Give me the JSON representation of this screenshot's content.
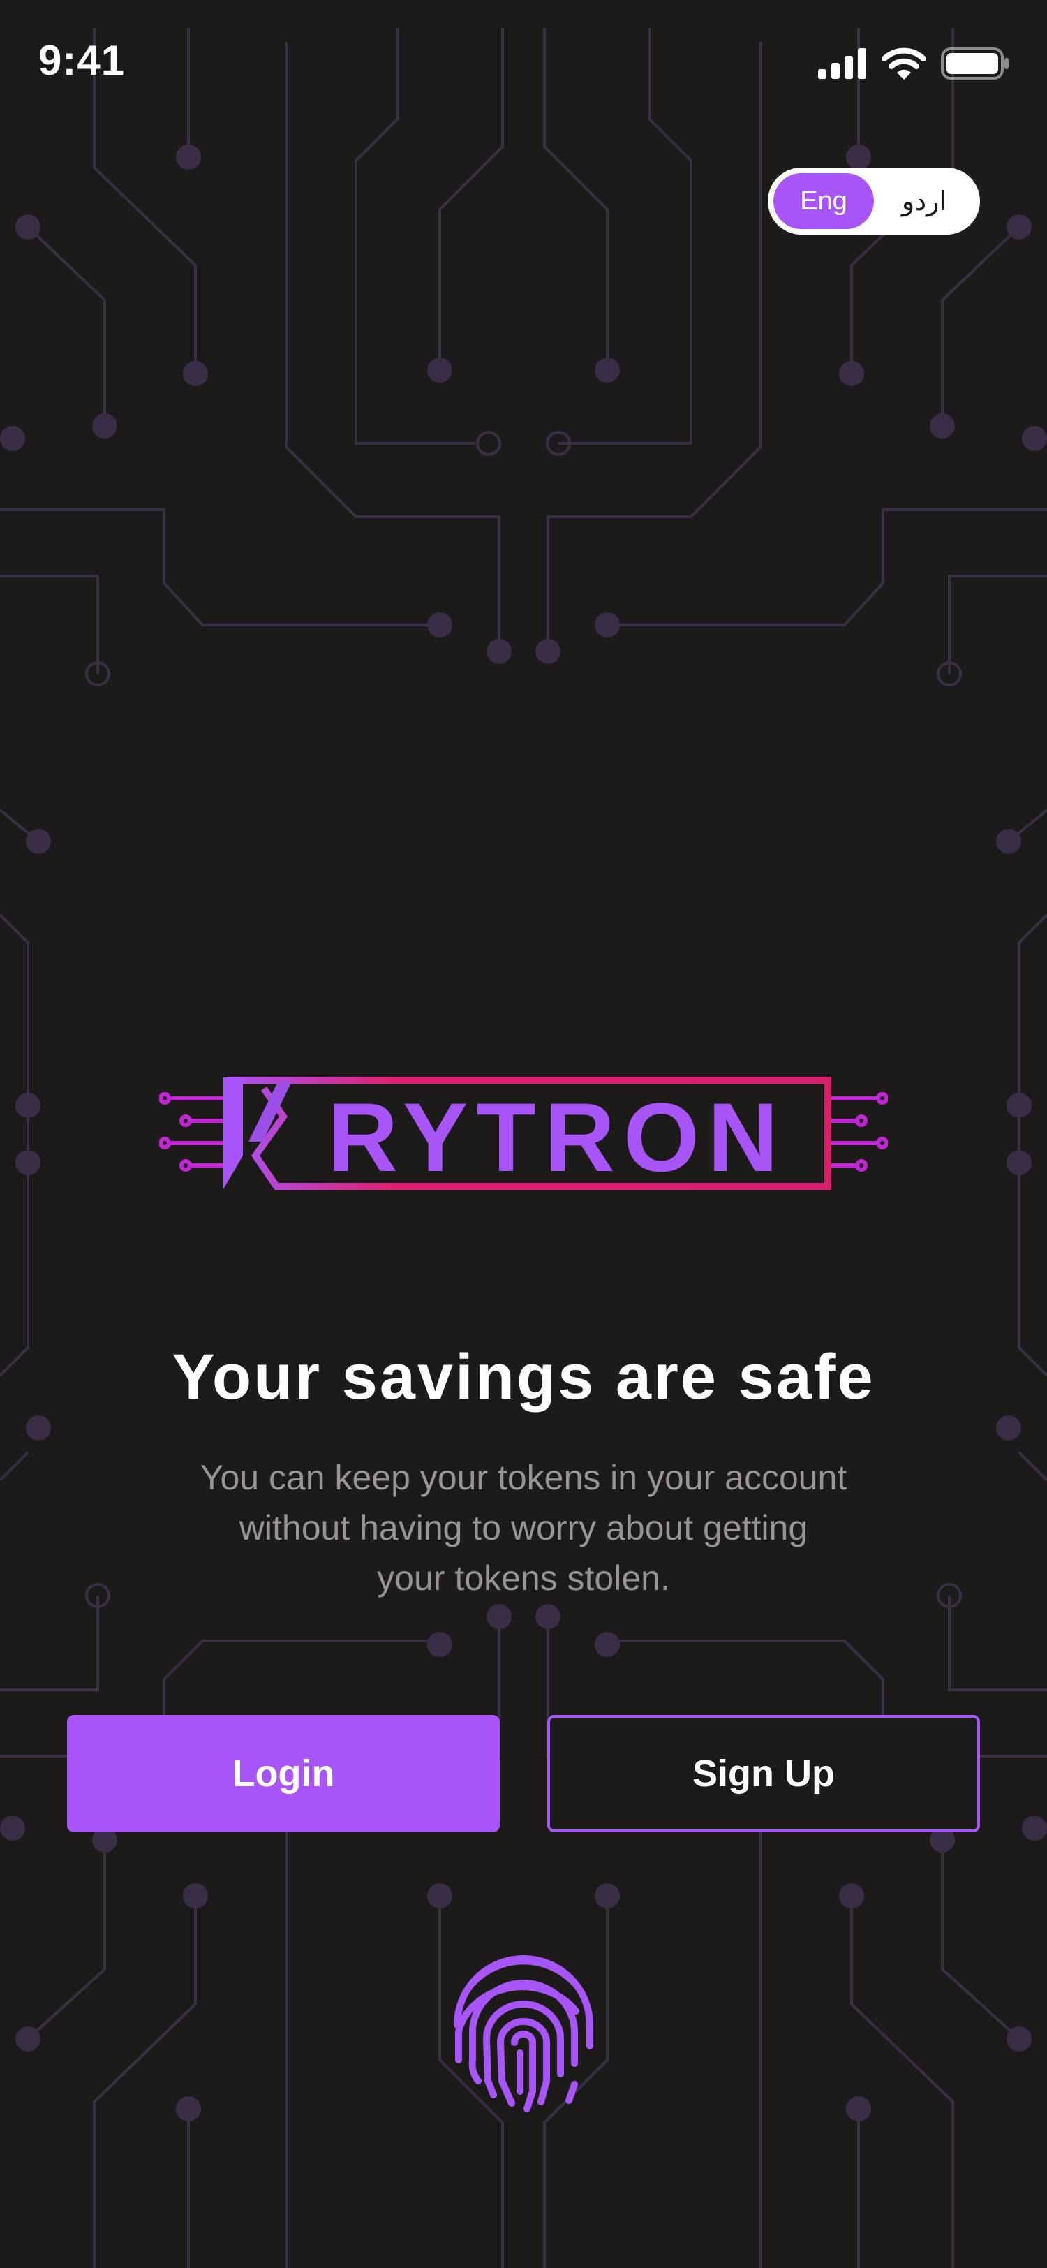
{
  "status_bar": {
    "time": "9:41",
    "icons": [
      "signal-icon",
      "wifi-icon",
      "battery-icon"
    ]
  },
  "language": {
    "options": [
      "Eng",
      "اردو"
    ],
    "selected": "Eng"
  },
  "logo": {
    "k_letter": "K",
    "wordmark": "RYTRON",
    "colors": {
      "purple": "#a855f7",
      "pink": "#e0206e"
    }
  },
  "hero": {
    "title": "Your savings are safe",
    "subtitle_lines": [
      "You can keep your tokens in your account",
      "without having to worry about getting",
      "your tokens stolen."
    ]
  },
  "actions": {
    "login_label": "Login",
    "signup_label": "Sign Up"
  },
  "biometric": {
    "icon": "fingerprint-icon"
  },
  "colors": {
    "background": "#1d1a1a",
    "accent": "#a855f7",
    "circuit": "#3b2f45",
    "text_muted": "#9a9498"
  }
}
